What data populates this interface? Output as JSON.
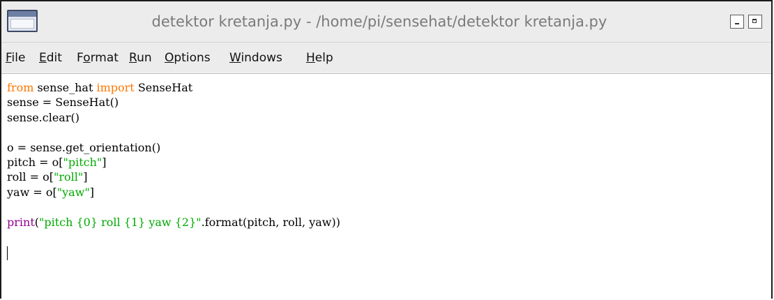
{
  "window": {
    "title": "detektor kretanja.py - /home/pi/sensehat/detektor kretanja.py",
    "icon": "idle-window-icon",
    "controls": [
      "minimize-icon",
      "maximize-icon"
    ]
  },
  "menu": [
    {
      "mnemonic": "F",
      "rest": "ile",
      "label": "File"
    },
    {
      "mnemonic": "E",
      "rest": "dit",
      "label": "Edit"
    },
    {
      "pre": "F",
      "mnemonic": "o",
      "rest": "rmat",
      "label": "Format"
    },
    {
      "mnemonic": "R",
      "rest": "un",
      "label": "Run"
    },
    {
      "mnemonic": "O",
      "rest": "ptions",
      "label": "Options"
    },
    {
      "mnemonic": "W",
      "rest": "indows",
      "label": "Windows"
    },
    {
      "mnemonic": "H",
      "rest": "elp",
      "label": "Help"
    }
  ],
  "editor": {
    "lines": [
      [
        {
          "t": "from",
          "c": "kw"
        },
        {
          "t": " sense_hat "
        },
        {
          "t": "import",
          "c": "kw"
        },
        {
          "t": " SenseHat"
        }
      ],
      [
        {
          "t": "sense = SenseHat()"
        }
      ],
      [
        {
          "t": "sense.clear()"
        }
      ],
      [],
      [
        {
          "t": "o = sense.get_orientation()"
        }
      ],
      [
        {
          "t": "pitch = o["
        },
        {
          "t": "\"pitch\"",
          "c": "str"
        },
        {
          "t": "]"
        }
      ],
      [
        {
          "t": "roll = o["
        },
        {
          "t": "\"roll\"",
          "c": "str"
        },
        {
          "t": "]"
        }
      ],
      [
        {
          "t": "yaw = o["
        },
        {
          "t": "\"yaw\"",
          "c": "str"
        },
        {
          "t": "]"
        }
      ],
      [],
      [
        {
          "t": "print",
          "c": "bi"
        },
        {
          "t": "("
        },
        {
          "t": "\"pitch {0} roll {1} yaw {2}\"",
          "c": "str"
        },
        {
          "t": ".format(pitch, roll, yaw))"
        }
      ]
    ],
    "colors": {
      "keyword": "#ff7700",
      "builtin": "#900090",
      "string": "#00aa00",
      "text": "#000000"
    }
  }
}
